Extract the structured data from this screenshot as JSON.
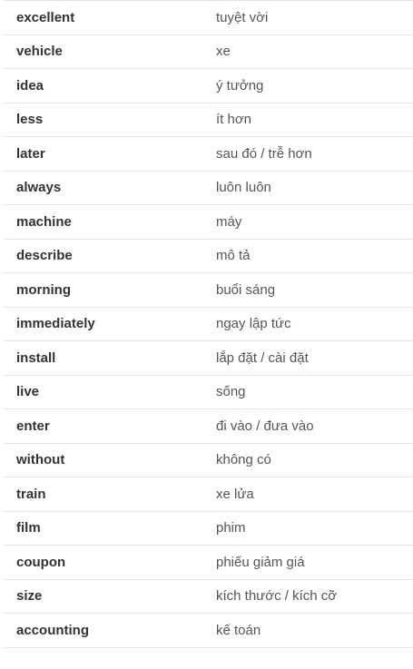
{
  "vocab": [
    {
      "en": "excellent",
      "vi": "tuyệt vời"
    },
    {
      "en": "vehicle",
      "vi": "xe"
    },
    {
      "en": "idea",
      "vi": "ý tưởng"
    },
    {
      "en": "less",
      "vi": "ít hơn"
    },
    {
      "en": "later",
      "vi": "sau đó / trễ hơn"
    },
    {
      "en": "always",
      "vi": "luôn luôn"
    },
    {
      "en": "machine",
      "vi": "máy"
    },
    {
      "en": "describe",
      "vi": "mô tả"
    },
    {
      "en": "morning",
      "vi": "buổi sáng"
    },
    {
      "en": "immediately",
      "vi": "ngay lập tức"
    },
    {
      "en": "install",
      "vi": "lắp đặt / cài đặt"
    },
    {
      "en": "live",
      "vi": "sống"
    },
    {
      "en": "enter",
      "vi": "đi vào / đưa vào"
    },
    {
      "en": "without",
      "vi": "không có"
    },
    {
      "en": "train",
      "vi": "xe lửa"
    },
    {
      "en": "film",
      "vi": "phim"
    },
    {
      "en": "coupon",
      "vi": "phiếu giảm giá"
    },
    {
      "en": "size",
      "vi": "kích thước / kích cỡ"
    },
    {
      "en": "accounting",
      "vi": "kế toán"
    }
  ]
}
